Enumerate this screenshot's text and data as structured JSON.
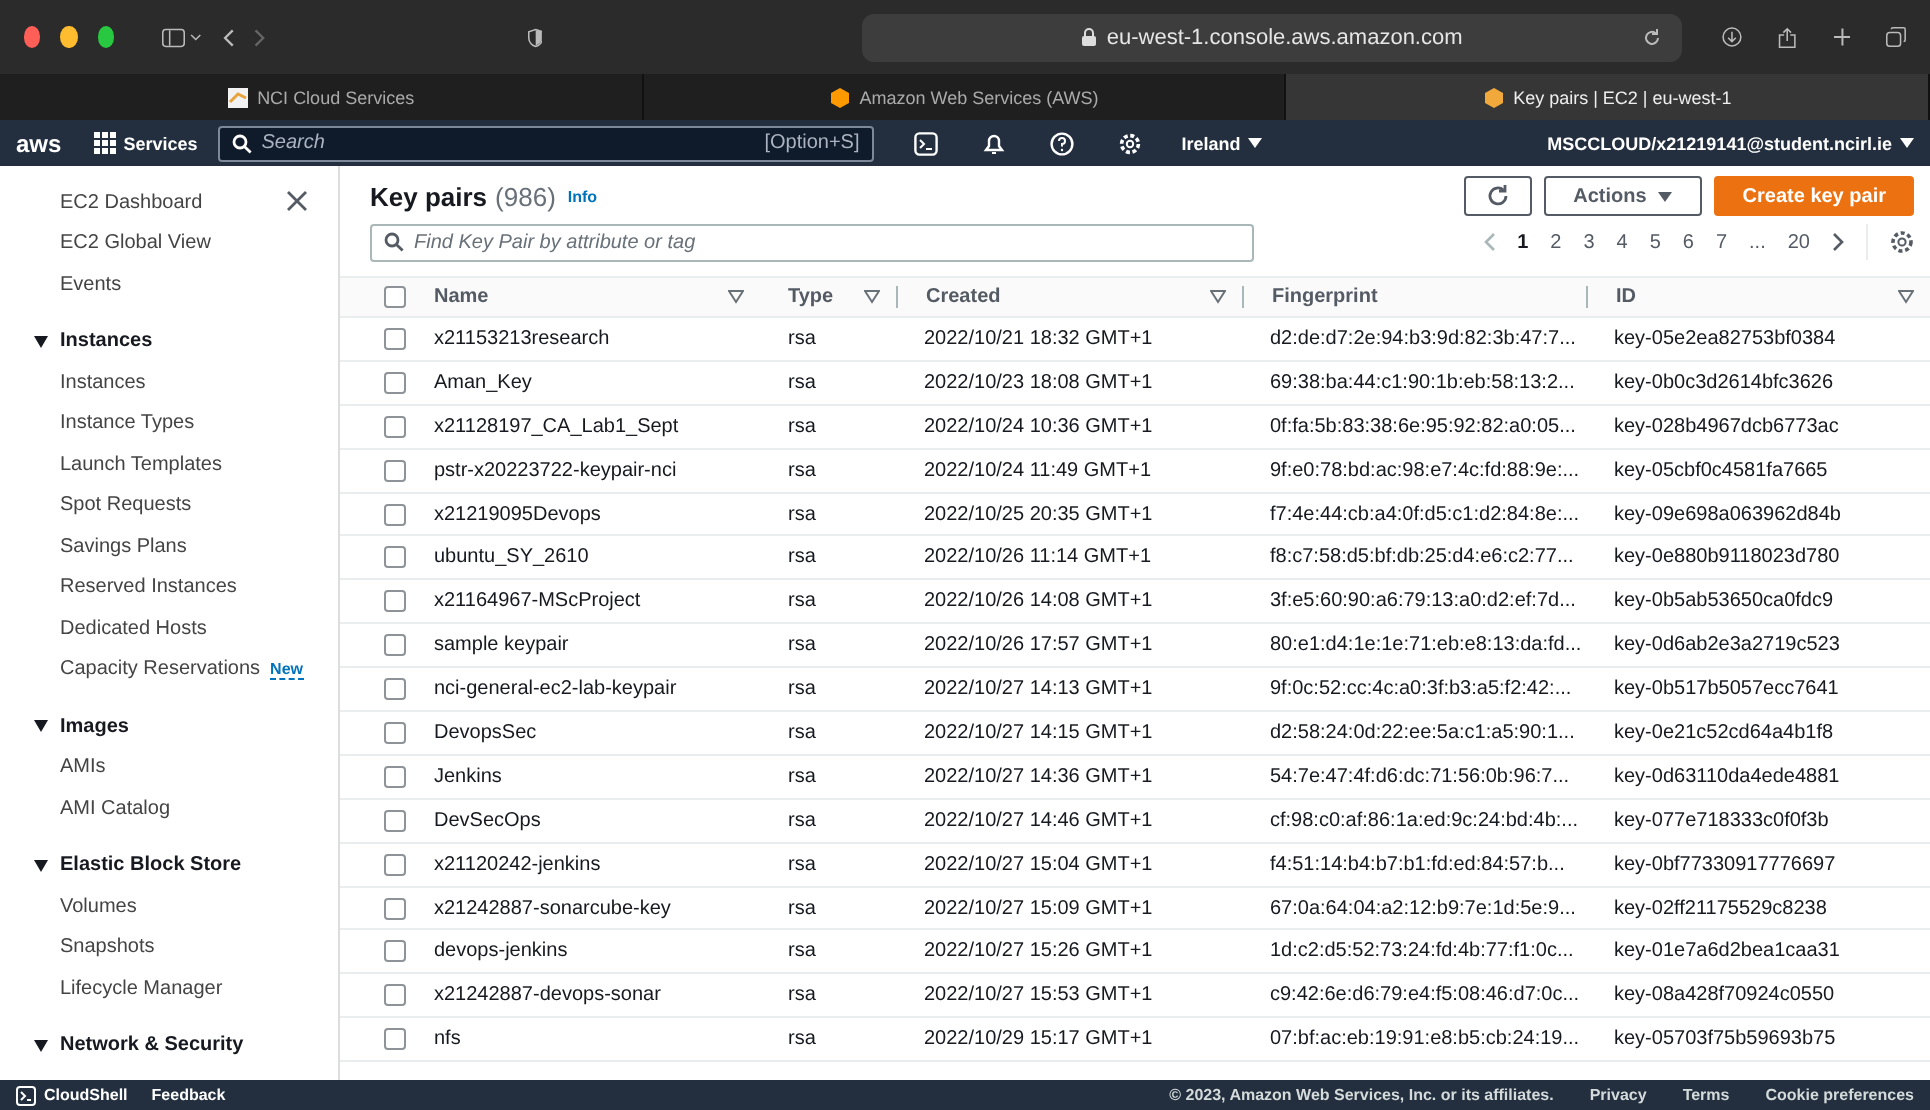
{
  "browser": {
    "url": "eu-west-1.console.aws.amazon.com",
    "tabs": [
      {
        "label": "NCI Cloud Services",
        "selected": false
      },
      {
        "label": "Amazon Web Services (AWS)",
        "selected": false
      },
      {
        "label": "Key pairs | EC2 | eu-west-1",
        "selected": true
      }
    ]
  },
  "topnav": {
    "logo": "aws",
    "services": "Services",
    "search_placeholder": "Search",
    "shortcut": "[Option+S]",
    "region": "Ireland",
    "account": "MSCCLOUD/x21219141@student.ncirl.ie"
  },
  "sidebar": {
    "items": [
      {
        "kind": "item",
        "label": "EC2 Dashboard"
      },
      {
        "kind": "item",
        "label": "EC2 Global View"
      },
      {
        "kind": "item",
        "label": "Events"
      },
      {
        "kind": "section",
        "label": "Instances",
        "expanded": true
      },
      {
        "kind": "item",
        "label": "Instances"
      },
      {
        "kind": "item",
        "label": "Instance Types"
      },
      {
        "kind": "item",
        "label": "Launch Templates"
      },
      {
        "kind": "item",
        "label": "Spot Requests"
      },
      {
        "kind": "item",
        "label": "Savings Plans"
      },
      {
        "kind": "item",
        "label": "Reserved Instances"
      },
      {
        "kind": "item",
        "label": "Dedicated Hosts"
      },
      {
        "kind": "item",
        "label": "Capacity Reservations",
        "badge": "New"
      },
      {
        "kind": "section",
        "label": "Images",
        "expanded": true
      },
      {
        "kind": "item",
        "label": "AMIs"
      },
      {
        "kind": "item",
        "label": "AMI Catalog"
      },
      {
        "kind": "section",
        "label": "Elastic Block Store",
        "expanded": true
      },
      {
        "kind": "item",
        "label": "Volumes"
      },
      {
        "kind": "item",
        "label": "Snapshots"
      },
      {
        "kind": "item",
        "label": "Lifecycle Manager"
      },
      {
        "kind": "section",
        "label": "Network & Security",
        "expanded": true
      }
    ]
  },
  "main": {
    "title": "Key pairs",
    "count": "(986)",
    "info": "Info",
    "actions": "Actions",
    "create": "Create key pair",
    "search_placeholder": "Find Key Pair by attribute or tag",
    "pages": [
      {
        "label": "1",
        "selected": true
      },
      {
        "label": "2",
        "selected": false
      },
      {
        "label": "3",
        "selected": false
      },
      {
        "label": "4",
        "selected": false
      },
      {
        "label": "5",
        "selected": false
      },
      {
        "label": "6",
        "selected": false
      },
      {
        "label": "7",
        "selected": false
      },
      {
        "label": "...",
        "selected": false
      },
      {
        "label": "20",
        "selected": false
      }
    ]
  },
  "table": {
    "select_all_checked": false,
    "columns": [
      {
        "label": "Name",
        "filter": true
      },
      {
        "label": "Type",
        "filter": true
      },
      {
        "label": "Created",
        "filter": true
      },
      {
        "label": "Fingerprint",
        "filter": false
      },
      {
        "label": "ID",
        "filter": true
      }
    ],
    "rows": [
      {
        "checked": false,
        "cells": [
          "x21153213research",
          "rsa",
          "2022/10/21 18:32 GMT+1",
          "d2:de:d7:2e:94:b3:9d:82:3b:47:7...",
          "key-05e2ea82753bf0384"
        ]
      },
      {
        "checked": false,
        "cells": [
          "Aman_Key",
          "rsa",
          "2022/10/23 18:08 GMT+1",
          "69:38:ba:44:c1:90:1b:eb:58:13:2...",
          "key-0b0c3d2614bfc3626"
        ]
      },
      {
        "checked": false,
        "cells": [
          "x21128197_CA_Lab1_Sept",
          "rsa",
          "2022/10/24 10:36 GMT+1",
          "0f:fa:5b:83:38:6e:95:92:82:a0:05...",
          "key-028b4967dcb6773ac"
        ]
      },
      {
        "checked": false,
        "cells": [
          "pstr-x20223722-keypair-nci",
          "rsa",
          "2022/10/24 11:49 GMT+1",
          "9f:e0:78:bd:ac:98:e7:4c:fd:88:9e:...",
          "key-05cbf0c4581fa7665"
        ]
      },
      {
        "checked": false,
        "cells": [
          "x21219095Devops",
          "rsa",
          "2022/10/25 20:35 GMT+1",
          "f7:4e:44:cb:a4:0f:d5:c1:d2:84:8e:...",
          "key-09e698a063962d84b"
        ]
      },
      {
        "checked": false,
        "cells": [
          "ubuntu_SY_2610",
          "rsa",
          "2022/10/26 11:14 GMT+1",
          "f8:c7:58:d5:bf:db:25:d4:e6:c2:77...",
          "key-0e880b9118023d780"
        ]
      },
      {
        "checked": false,
        "cells": [
          "x21164967-MScProject",
          "rsa",
          "2022/10/26 14:08 GMT+1",
          "3f:e5:60:90:a6:79:13:a0:d2:ef:7d...",
          "key-0b5ab53650ca0fdc9"
        ]
      },
      {
        "checked": false,
        "cells": [
          "sample keypair",
          "rsa",
          "2022/10/26 17:57 GMT+1",
          "80:e1:d4:1e:1e:71:eb:e8:13:da:fd...",
          "key-0d6ab2e3a2719c523"
        ]
      },
      {
        "checked": false,
        "cells": [
          "nci-general-ec2-lab-keypair",
          "rsa",
          "2022/10/27 14:13 GMT+1",
          "9f:0c:52:cc:4c:a0:3f:b3:a5:f2:42:...",
          "key-0b517b5057ecc7641"
        ]
      },
      {
        "checked": false,
        "cells": [
          "DevopsSec",
          "rsa",
          "2022/10/27 14:15 GMT+1",
          "d2:58:24:0d:22:ee:5a:c1:a5:90:1...",
          "key-0e21c52cd64a4b1f8"
        ]
      },
      {
        "checked": false,
        "cells": [
          "Jenkins",
          "rsa",
          "2022/10/27 14:36 GMT+1",
          "54:7e:47:4f:d6:dc:71:56:0b:96:7...",
          "key-0d63110da4ede4881"
        ]
      },
      {
        "checked": false,
        "cells": [
          "DevSecOps",
          "rsa",
          "2022/10/27 14:46 GMT+1",
          "cf:98:c0:af:86:1a:ed:9c:24:bd:4b:...",
          "key-077e718333c0f0f3b"
        ]
      },
      {
        "checked": false,
        "cells": [
          "x21120242-jenkins",
          "rsa",
          "2022/10/27 15:04 GMT+1",
          "f4:51:14:b4:b7:b1:fd:ed:84:57:b...",
          "key-0bf77330917776697"
        ]
      },
      {
        "checked": false,
        "cells": [
          "x21242887-sonarcube-key",
          "rsa",
          "2022/10/27 15:09 GMT+1",
          "67:0a:64:04:a2:12:b9:7e:1d:5e:9...",
          "key-02ff21175529c8238"
        ]
      },
      {
        "checked": false,
        "cells": [
          "devops-jenkins",
          "rsa",
          "2022/10/27 15:26 GMT+1",
          "1d:c2:d5:52:73:24:fd:4b:77:f1:0c...",
          "key-01e7a6d2bea1caa31"
        ]
      },
      {
        "checked": false,
        "cells": [
          "x21242887-devops-sonar",
          "rsa",
          "2022/10/27 15:53 GMT+1",
          "c9:42:6e:d6:79:e4:f5:08:46:d7:0c...",
          "key-08a428f70924c0550"
        ]
      },
      {
        "checked": false,
        "cells": [
          "nfs",
          "rsa",
          "2022/10/29 15:17 GMT+1",
          "07:bf:ac:eb:19:91:e8:b5:cb:24:19...",
          "key-05703f75b59693b75"
        ]
      }
    ]
  },
  "footer": {
    "cloudshell": "CloudShell",
    "feedback": "Feedback",
    "copyright": "© 2023, Amazon Web Services, Inc. or its affiliates.",
    "links": [
      "Privacy",
      "Terms",
      "Cookie preferences"
    ]
  }
}
